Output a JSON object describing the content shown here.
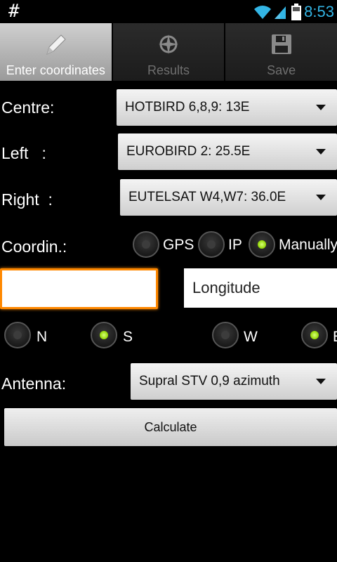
{
  "status_bar": {
    "left_symbol": "#",
    "time": "8:53"
  },
  "tabs": [
    {
      "label": "Enter coordinates",
      "icon": "pencil-icon",
      "active": true
    },
    {
      "label": "Results",
      "icon": "compass-icon",
      "active": false
    },
    {
      "label": "Save",
      "icon": "floppy-disk-icon",
      "active": false
    }
  ],
  "form": {
    "centre_label": "Centre:",
    "centre_value": "HOTBIRD 6,8,9: 13E",
    "left_label": "Left   :",
    "left_value": "EUROBIRD 2: 25.5E",
    "right_label": "Right  :",
    "right_value": "EUTELSAT W4,W7: 36.0E",
    "coordin_label": "Coordin.:",
    "coord_options": [
      {
        "label": "GPS",
        "checked": false
      },
      {
        "label": "IP",
        "checked": false
      },
      {
        "label": "Manually",
        "checked": true
      }
    ],
    "latitude_value": "",
    "longitude_placeholder": "Longitude",
    "ns_options": [
      {
        "label": "N",
        "checked": false
      },
      {
        "label": "S",
        "checked": true
      }
    ],
    "ew_options": [
      {
        "label": "W",
        "checked": false
      },
      {
        "label": "E",
        "checked": true
      }
    ],
    "antenna_label": "Antenna:",
    "antenna_value": "Supral STV 0,9 azimuth",
    "calculate_label": "Calculate"
  },
  "colors": {
    "accent_blue": "#33b5e5",
    "focus_orange": "#ff8800",
    "radio_green": "#8fd400"
  }
}
